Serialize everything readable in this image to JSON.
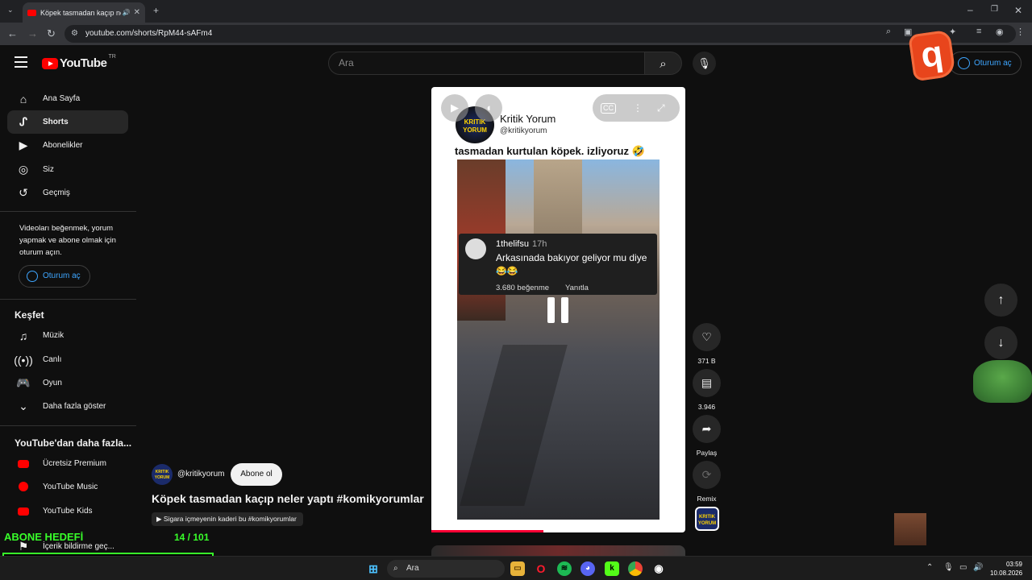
{
  "browser": {
    "tab_title": "Köpek tasmadan kaçıp neler",
    "url": "youtube.com/shorts/RpM44-sAFm4"
  },
  "youtube": {
    "logo_text": "YouTube",
    "country_code": "TR",
    "search_placeholder": "Ara",
    "signin_label": "Oturum aç"
  },
  "sidebar": {
    "main": [
      {
        "label": "Ana Sayfa",
        "icon": "home-icon"
      },
      {
        "label": "Shorts",
        "icon": "shorts-icon",
        "active": true
      },
      {
        "label": "Abonelikler",
        "icon": "subscriptions-icon"
      },
      {
        "label": "Siz",
        "icon": "user-icon"
      },
      {
        "label": "Geçmiş",
        "icon": "history-icon"
      }
    ],
    "signin_note": "Videoları beğenmek, yorum yapmak ve abone olmak için oturum açın.",
    "signin_button": "Oturum aç",
    "explore_heading": "Keşfet",
    "explore": [
      {
        "label": "Müzik",
        "icon": "music-icon"
      },
      {
        "label": "Canlı",
        "icon": "live-icon"
      },
      {
        "label": "Oyun",
        "icon": "gaming-icon"
      },
      {
        "label": "Daha fazla göster",
        "icon": "chevron-down-icon"
      }
    ],
    "more_heading": "YouTube'dan daha fazla...",
    "more": [
      {
        "label": "Ücretsiz Premium"
      },
      {
        "label": "YouTube Music"
      },
      {
        "label": "YouTube Kids"
      }
    ],
    "report_label": "İçerik bildirme geç..."
  },
  "short": {
    "channel_name": "Kritik Yorum",
    "channel_handle": "@kritikyorum",
    "avatar_text": "KRITIK YORUM",
    "caption": "tasmadan kurtulan köpek. izliyoruz 🤣",
    "comment": {
      "user": "1thelifsu",
      "time": "17h",
      "text": "Arkasınada bakıyor geliyor mu diye",
      "emoji": "😂😂",
      "likes": "3.680 beğenme",
      "reply": "Yanıtla"
    },
    "progress_fraction": 0.44
  },
  "actions": {
    "like_count": "371 B",
    "comment_count": "3.946",
    "share_label": "Paylaş",
    "remix_label": "Remix"
  },
  "below": {
    "handle": "@kritikyorum",
    "subscribe": "Abone ol",
    "title": "Köpek tasmadan kaçıp neler yaptı #komikyorumlar",
    "chip": "Sigara içmeyenin kaderi bu #komikyorumlar"
  },
  "overlay": {
    "goal_label": "ABONE HEDEFİ",
    "goal_count": "14 / 101"
  },
  "taskbar": {
    "search": "Ara",
    "time": "03:59",
    "date": "10.08.2026"
  }
}
